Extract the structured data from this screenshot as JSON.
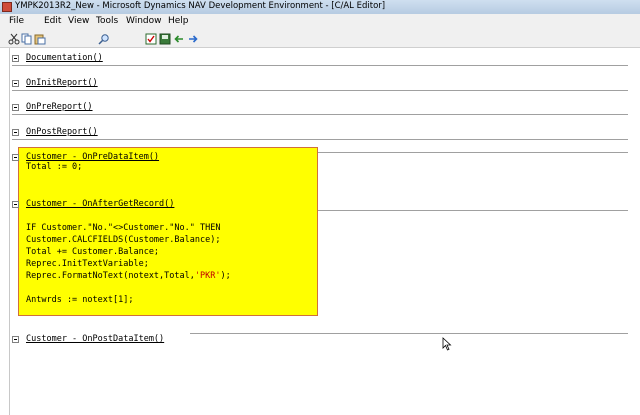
{
  "window": {
    "title": "YMPK2013R2_New - Microsoft Dynamics NAV Development Environment - [C/AL Editor]"
  },
  "menu": {
    "items": [
      "File",
      "Edit",
      "View",
      "Tools",
      "Window",
      "Help"
    ]
  },
  "toolbar": {
    "icons": [
      "cut-icon",
      "copy-icon",
      "paste-icon",
      "find-icon",
      "compile-icon",
      "save-icon",
      "back-icon",
      "forward-icon"
    ]
  },
  "editor": {
    "triggers": [
      {
        "name": "Documentation()"
      },
      {
        "name": "OnInitReport()"
      },
      {
        "name": "OnPreReport()"
      },
      {
        "name": "OnPostReport()"
      },
      {
        "name": "Customer - OnPreDataItem()"
      },
      {
        "name": "Customer - OnAfterGetRecord()"
      },
      {
        "name": "Customer - OnPostDataItem()"
      }
    ],
    "code": {
      "onpredataitem": [
        "Total := 0;"
      ],
      "onaftergetrecord": [
        "IF Customer.\"No.\"<>Customer.\"No.\" THEN",
        "Customer.CALCFIELDS(Customer.Balance);",
        "Total += Customer.Balance;",
        "Reprec.InitTextVariable;",
        "Reprec.FormatNoText(notext,Total,",
        "'PKR'",
        ");",
        "Antwrds := notext[1];"
      ]
    },
    "highlight_color": "#ffff00"
  }
}
